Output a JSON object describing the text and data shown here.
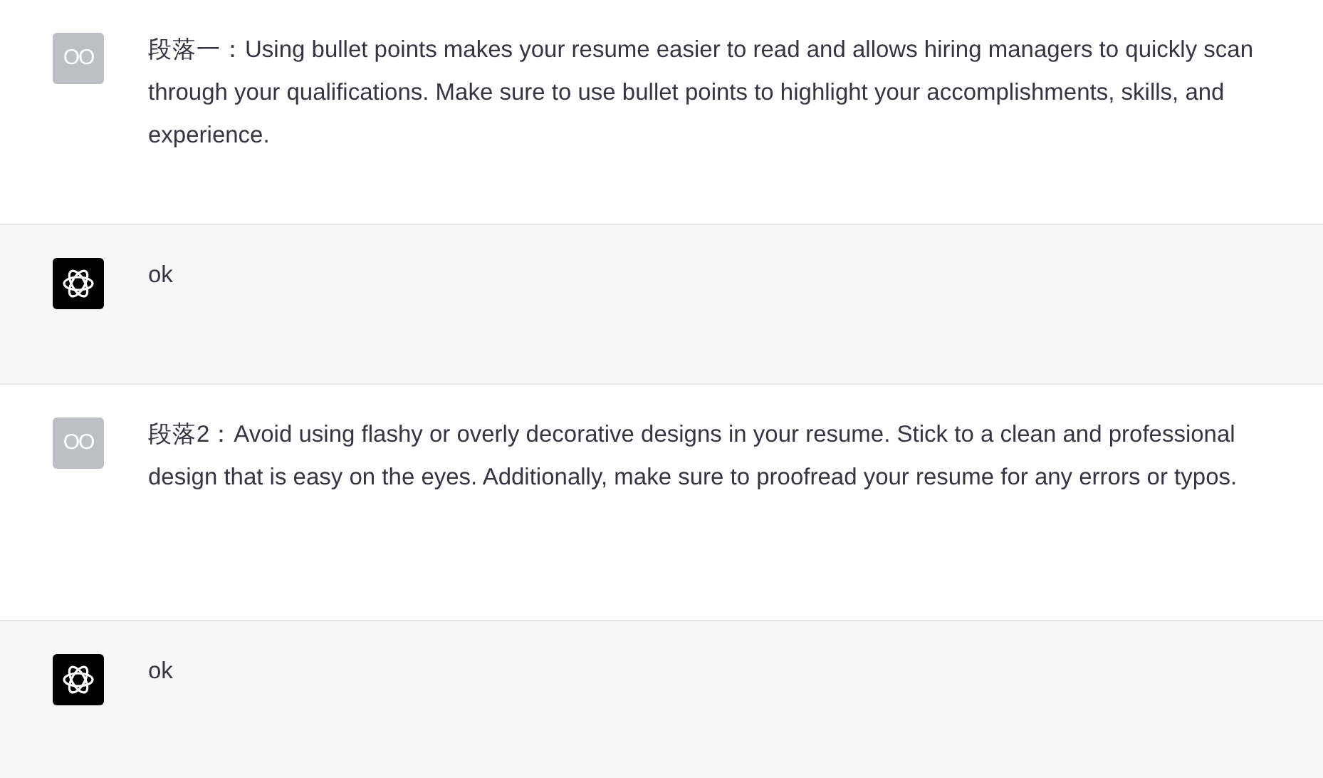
{
  "messages": [
    {
      "kind": "user",
      "avatar": "OO",
      "text": "段落一：Using bullet points makes your resume easier to read and allows hiring managers to quickly scan through your qualifications. Make sure to use bullet points to highlight your accomplishments, skills, and experience."
    },
    {
      "kind": "assistant",
      "text": "ok"
    },
    {
      "kind": "user",
      "avatar": "OO",
      "text": "段落2：Avoid using flashy or overly decorative designs in your resume. Stick to a clean and professional design that is easy on the eyes. Additionally, make sure to proofread your resume for any errors or typos."
    },
    {
      "kind": "assistant",
      "text": "ok"
    }
  ]
}
